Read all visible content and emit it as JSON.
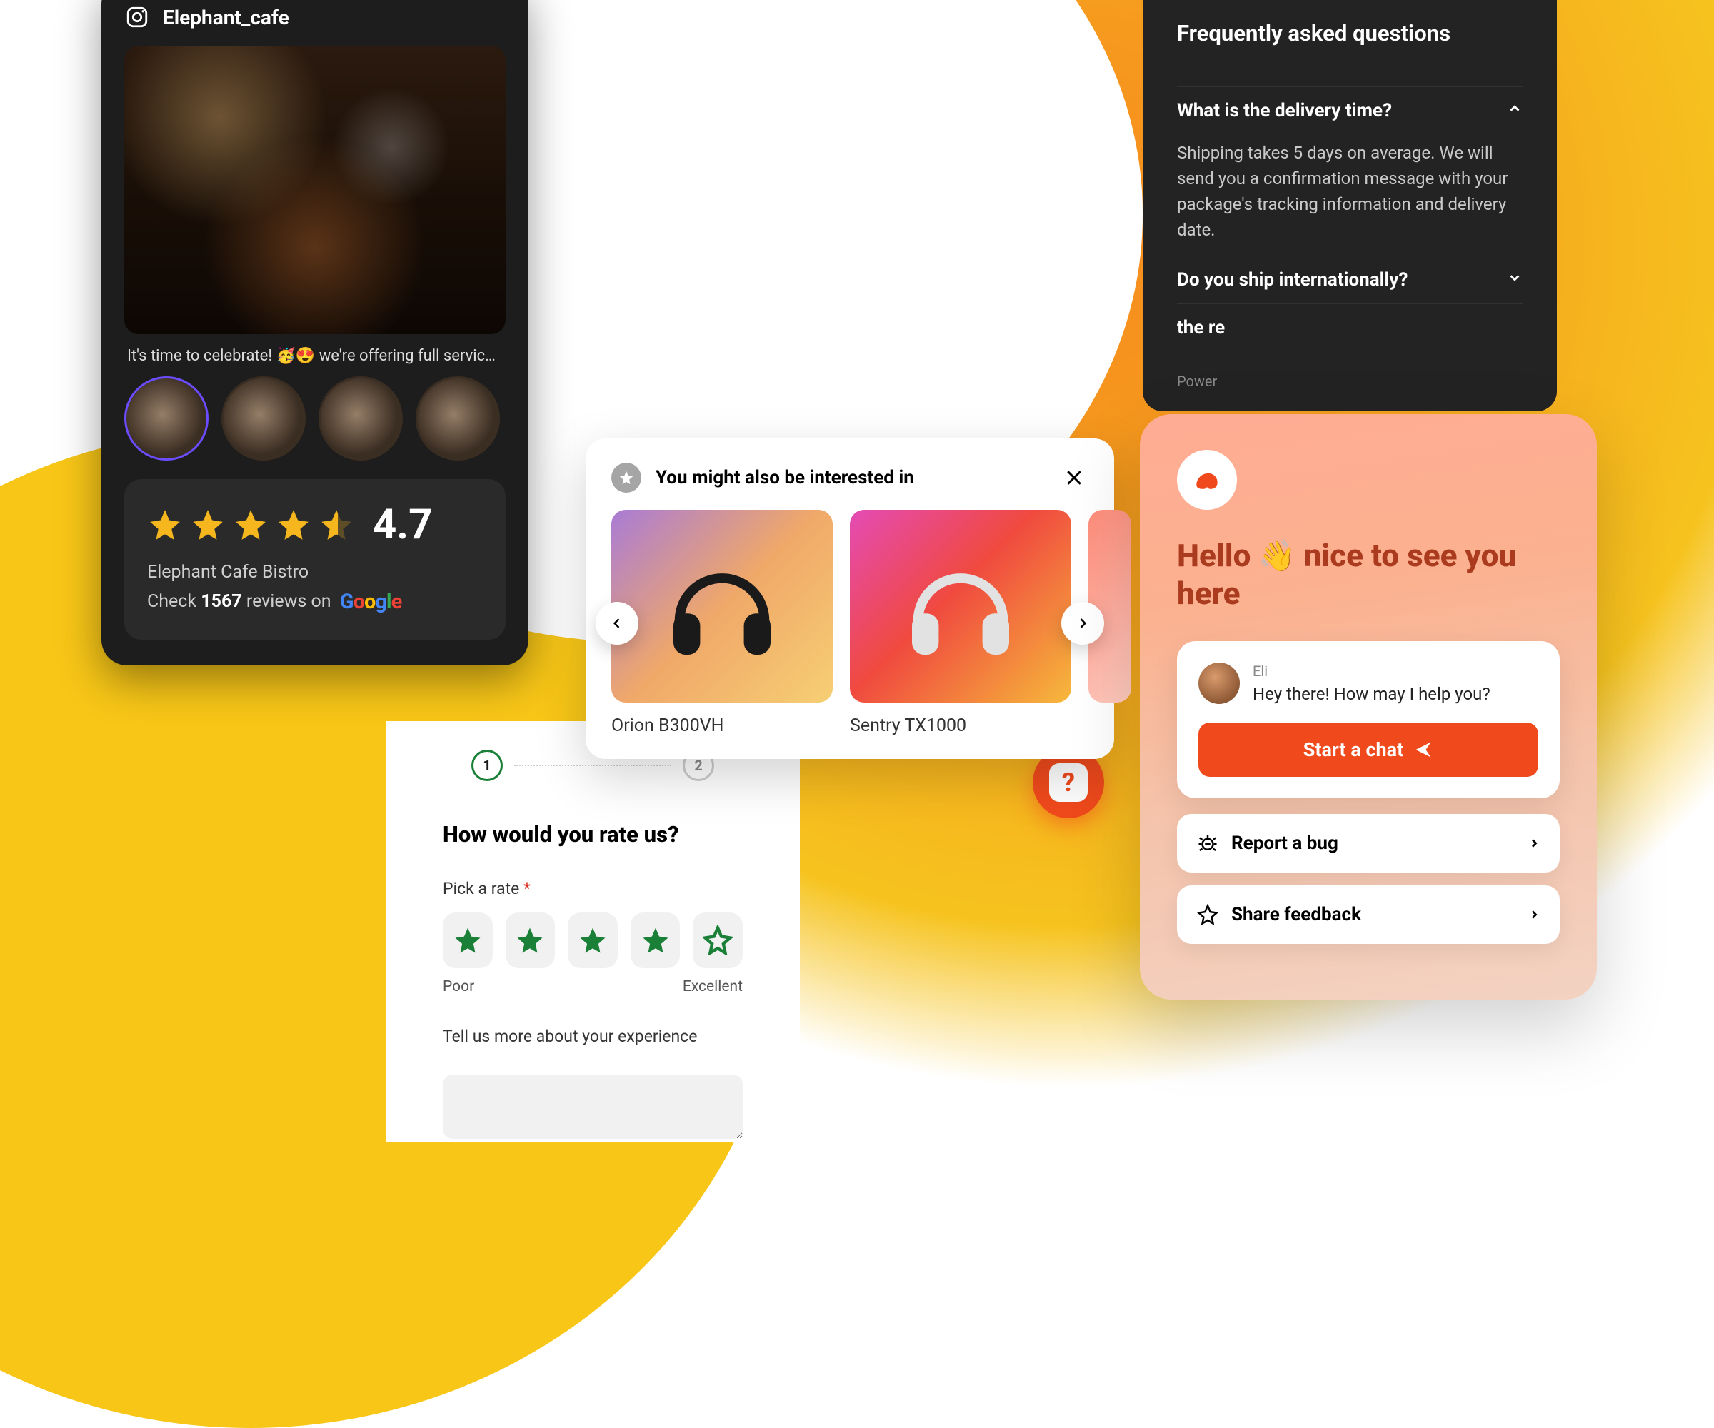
{
  "insta": {
    "handle": "Elephant_cafe",
    "caption": "It's time to celebrate! 🥳😍 we're offering full service to…",
    "rating_value": "4.7",
    "business_name": "Elephant Cafe Bistro",
    "review_prefix": "Check ",
    "review_count": "1567",
    "review_suffix": " reviews on "
  },
  "faq": {
    "title": "Frequently asked questions",
    "items": [
      {
        "q": "What is the delivery time?",
        "expanded": true,
        "a": "Shipping takes 5 days on average. We will send you a confirmation message with your package's tracking information and delivery date."
      },
      {
        "q": "Do you ship internationally?",
        "expanded": false
      },
      {
        "q": "the re",
        "expanded": false
      }
    ],
    "powered": "Power"
  },
  "recs": {
    "title": "You might also be interested in",
    "items": [
      {
        "name": "Orion B300VH"
      },
      {
        "name": "Sentry TX1000"
      }
    ]
  },
  "survey": {
    "step1": "1",
    "step2": "2",
    "heading": "How would you rate us?",
    "rate_label": "Pick a rate ",
    "scale_low": "Poor",
    "scale_high": "Excellent",
    "textarea_label": "Tell us more about your experience"
  },
  "chat": {
    "hello_1": "Hello ",
    "hello_2": " nice to see you here",
    "agent_name": "Eli",
    "agent_msg": "Hey there! How may I help you?",
    "cta": "Start a chat",
    "option_bug": "Report a bug",
    "option_feedback": "Share feedback"
  },
  "help": {
    "glyph": "?"
  }
}
